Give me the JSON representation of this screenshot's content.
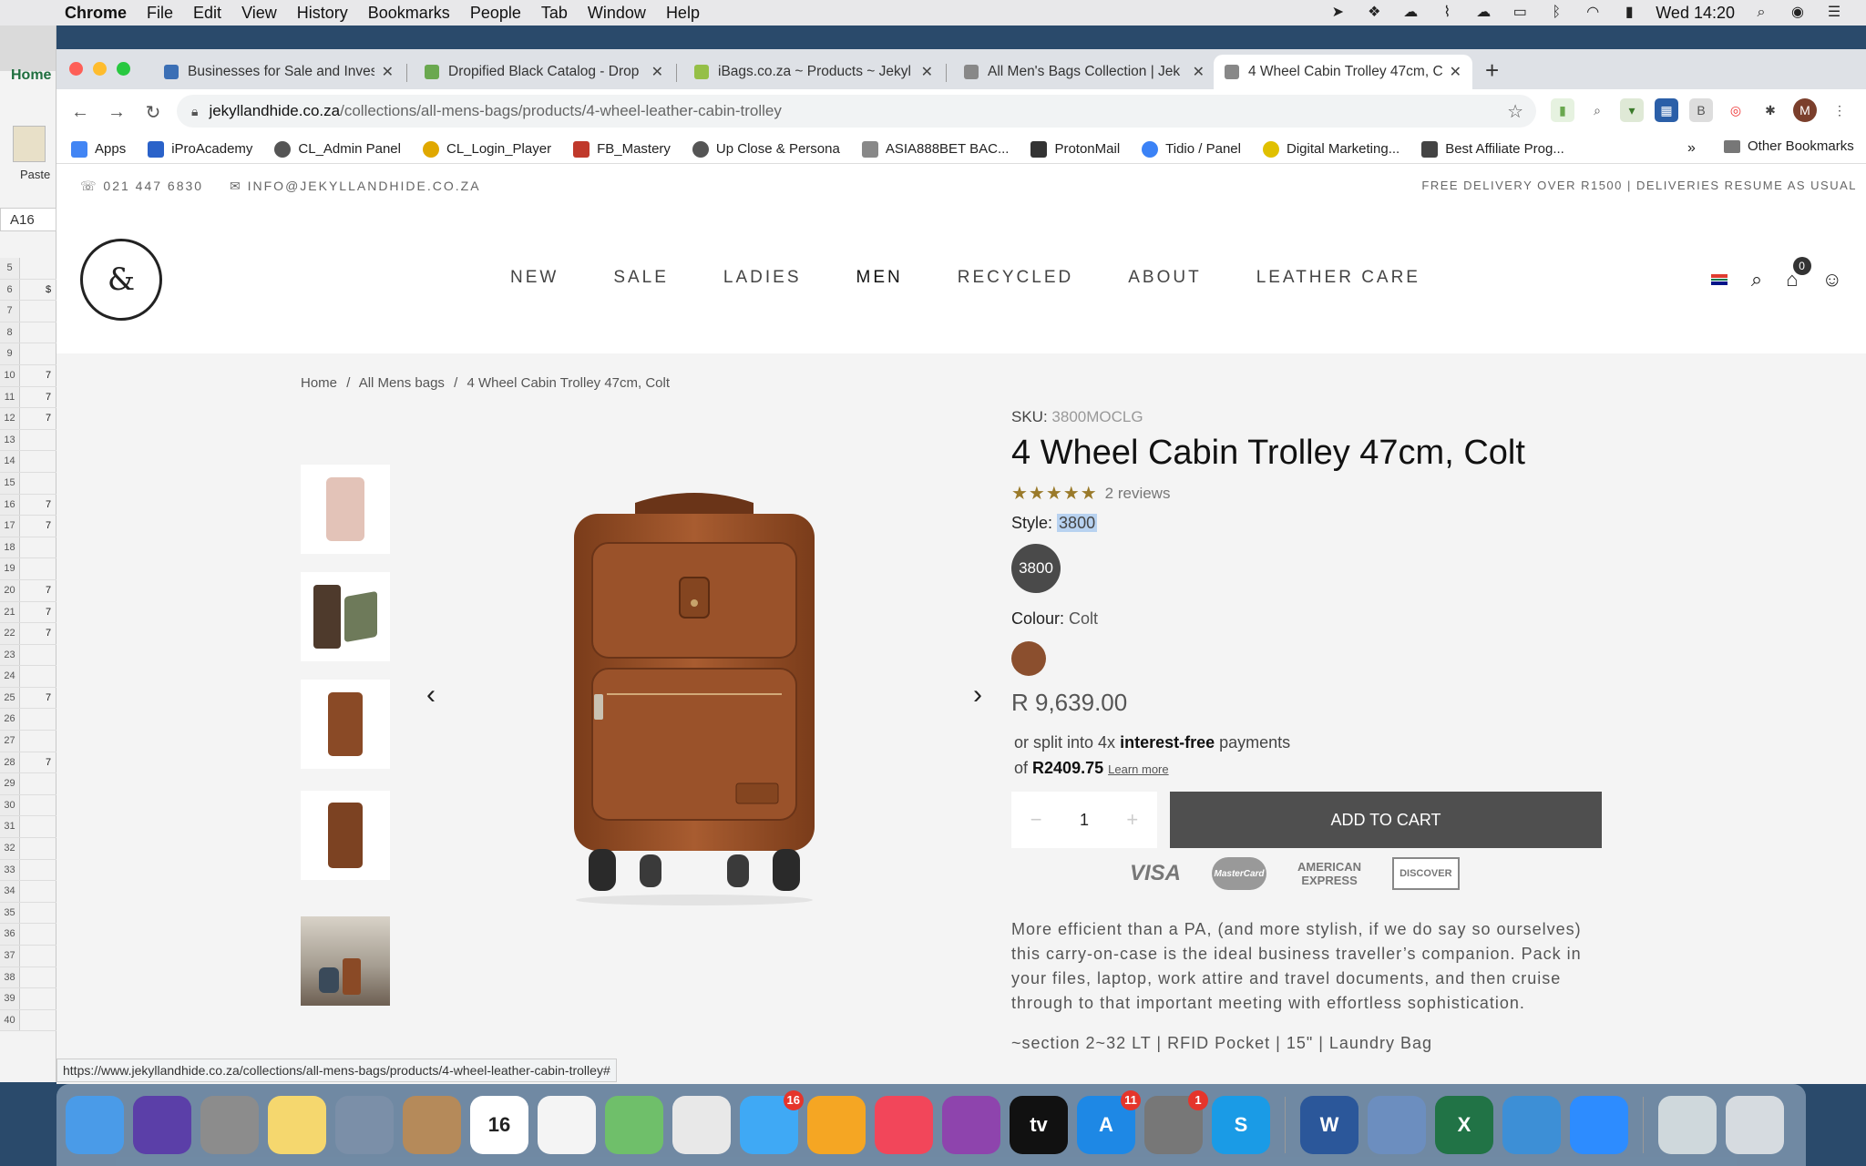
{
  "menubar": {
    "app": "Chrome",
    "items": [
      "File",
      "Edit",
      "View",
      "History",
      "Bookmarks",
      "People",
      "Tab",
      "Window",
      "Help"
    ],
    "clock": "Wed 14:20"
  },
  "excel": {
    "home_tab": "Home",
    "paste_label": "Paste",
    "cell_ref": "A16",
    "rows": [
      {
        "n": "5",
        "v": ""
      },
      {
        "n": "6",
        "v": "$"
      },
      {
        "n": "7",
        "v": ""
      },
      {
        "n": "8",
        "v": ""
      },
      {
        "n": "9",
        "v": ""
      },
      {
        "n": "10",
        "v": "7"
      },
      {
        "n": "11",
        "v": "7"
      },
      {
        "n": "12",
        "v": "7"
      },
      {
        "n": "13",
        "v": ""
      },
      {
        "n": "14",
        "v": ""
      },
      {
        "n": "15",
        "v": ""
      },
      {
        "n": "16",
        "v": "7"
      },
      {
        "n": "17",
        "v": "7"
      },
      {
        "n": "18",
        "v": ""
      },
      {
        "n": "19",
        "v": ""
      },
      {
        "n": "20",
        "v": "7"
      },
      {
        "n": "21",
        "v": "7"
      },
      {
        "n": "22",
        "v": "7"
      },
      {
        "n": "23",
        "v": ""
      },
      {
        "n": "24",
        "v": ""
      },
      {
        "n": "25",
        "v": "7"
      },
      {
        "n": "26",
        "v": ""
      },
      {
        "n": "27",
        "v": ""
      },
      {
        "n": "28",
        "v": "7"
      },
      {
        "n": "29",
        "v": ""
      },
      {
        "n": "30",
        "v": ""
      },
      {
        "n": "31",
        "v": ""
      },
      {
        "n": "32",
        "v": ""
      },
      {
        "n": "33",
        "v": ""
      },
      {
        "n": "34",
        "v": ""
      },
      {
        "n": "35",
        "v": ""
      },
      {
        "n": "36",
        "v": ""
      },
      {
        "n": "37",
        "v": ""
      },
      {
        "n": "38",
        "v": ""
      },
      {
        "n": "39",
        "v": ""
      },
      {
        "n": "40",
        "v": ""
      }
    ]
  },
  "tabs": [
    {
      "title": "Businesses for Sale and Investo",
      "color": "#3b6fb5"
    },
    {
      "title": "Dropified Black Catalog - Drop",
      "color": "#6aa84f"
    },
    {
      "title": "iBags.co.za ~ Products ~ Jekyl",
      "color": "#95bf47"
    },
    {
      "title": "All Men's Bags Collection | Jek",
      "color": "#888888"
    },
    {
      "title": "4 Wheel Cabin Trolley 47cm, C",
      "color": "#888888"
    }
  ],
  "toolbar": {
    "url_host": "jekyllandhide.co.za",
    "url_path": "/collections/all-mens-bags/products/4-wheel-leather-cabin-trolley",
    "avatar_letter": "M"
  },
  "bookmarks": {
    "items": [
      {
        "label": "Apps",
        "color": "#4285f4"
      },
      {
        "label": "iProAcademy",
        "color": "#2a62c9"
      },
      {
        "label": "CL_Admin Panel",
        "color": "#555555"
      },
      {
        "label": "CL_Login_Player",
        "color": "#e0a800"
      },
      {
        "label": "FB_Mastery",
        "color": "#c0392b"
      },
      {
        "label": "Up Close & Persona",
        "color": "#555555"
      },
      {
        "label": "ASIA888BET BAC...",
        "color": "#888888"
      },
      {
        "label": "ProtonMail",
        "color": "#333333"
      },
      {
        "label": "Tidio / Panel",
        "color": "#3b82f6"
      },
      {
        "label": "Digital Marketing...",
        "color": "#e0c000"
      },
      {
        "label": "Best Affiliate Prog...",
        "color": "#444444"
      }
    ],
    "more": "»",
    "other": "Other Bookmarks"
  },
  "site": {
    "phone": "021 447 6830",
    "email": "INFO@JEKYLLANDHIDE.CO.ZA",
    "delivery": "FREE DELIVERY OVER R1500 | DELIVERIES RESUME AS USUAL",
    "nav": [
      "NEW",
      "SALE",
      "LADIES",
      "MEN",
      "RECYCLED",
      "ABOUT",
      "LEATHER CARE"
    ],
    "active_nav": "MEN",
    "cart_count": "0",
    "breadcrumb": [
      "Home",
      "/",
      "All Mens bags",
      "/",
      "4 Wheel Cabin Trolley 47cm, Colt"
    ]
  },
  "product": {
    "sku_label": "SKU:",
    "sku": "3800MOCLG",
    "title": "4 Wheel Cabin Trolley 47cm, Colt",
    "stars": "★★★★★",
    "rating_value": 5,
    "reviews": "2 reviews",
    "style_label": "Style:",
    "style_value": "3800",
    "style_chip": "3800",
    "colour_label": "Colour:",
    "colour_value": "Colt",
    "colour_hex": "#8b4f2e",
    "price": "R 9,639.00",
    "split_pre": "or split into 4x",
    "split_bold": "interest-free",
    "split_post": "payments",
    "split_of": "of",
    "split_amount": "R2409.75",
    "learn_more": "Learn more",
    "qty_minus": "−",
    "quantity": "1",
    "qty_plus": "+",
    "add_to_cart": "ADD TO CART",
    "payment_methods": {
      "visa": "VISA",
      "mastercard": "MasterCard",
      "amex_1": "AMERICAN",
      "amex_2": "EXPRESS",
      "discover": "DISCOVER"
    },
    "description": "More efficient than a PA, (and more stylish, if we do say so ourselves) this carry-on-case is the ideal business traveller’s companion. Pack in your files, laptop, work attire and travel documents, and then cruise through to that important meeting with effortless sophistication.",
    "features": "~section 2~32 LT | RFID Pocket | 15\" | Laundry Bag"
  },
  "status_url": "https://www.jekyllandhide.co.za/collections/all-mens-bags/products/4-wheel-leather-cabin-trolley#",
  "dock": {
    "apps": [
      {
        "name": "finder-icon",
        "color": "#4a9be8",
        "label": "",
        "badge": ""
      },
      {
        "name": "siri-icon",
        "color": "#5b3fa8",
        "label": "",
        "badge": ""
      },
      {
        "name": "launchpad-icon",
        "color": "#8c8c8c",
        "label": "",
        "badge": ""
      },
      {
        "name": "notes-icon",
        "color": "#f5d76e",
        "label": "",
        "badge": ""
      },
      {
        "name": "mail-stamp-icon",
        "color": "#7b8fa8",
        "label": "",
        "badge": ""
      },
      {
        "name": "contacts-icon",
        "color": "#b58a5a",
        "label": "",
        "badge": ""
      },
      {
        "name": "calendar-icon",
        "color": "#ffffff",
        "label": "16",
        "badge": ""
      },
      {
        "name": "reminders-icon",
        "color": "#f4f4f4",
        "label": "",
        "badge": ""
      },
      {
        "name": "maps-icon",
        "color": "#6fbf6a",
        "label": "",
        "badge": ""
      },
      {
        "name": "chrome-icon",
        "color": "#e8e8e8",
        "label": "",
        "badge": ""
      },
      {
        "name": "messages-icon",
        "color": "#3fa9f5",
        "label": "",
        "badge": "16"
      },
      {
        "name": "photos-icon",
        "color": "#f5a623",
        "label": "",
        "badge": ""
      },
      {
        "name": "music-icon",
        "color": "#f2465a",
        "label": "",
        "badge": ""
      },
      {
        "name": "podcasts-icon",
        "color": "#8e44ad",
        "label": "",
        "badge": ""
      },
      {
        "name": "tv-icon",
        "color": "#111111",
        "label": "tv",
        "badge": ""
      },
      {
        "name": "app-store-icon",
        "color": "#1e88e5",
        "label": "A",
        "badge": "11"
      },
      {
        "name": "system-preferences-icon",
        "color": "#777777",
        "label": "",
        "badge": "1"
      },
      {
        "name": "skype-icon",
        "color": "#1a9be6",
        "label": "S",
        "badge": ""
      },
      {
        "name": "sep",
        "color": "",
        "label": "",
        "badge": ""
      },
      {
        "name": "word-icon",
        "color": "#2b579a",
        "label": "W",
        "badge": ""
      },
      {
        "name": "preview-icon",
        "color": "#6c8ebf",
        "label": "",
        "badge": ""
      },
      {
        "name": "excel-icon",
        "color": "#217346",
        "label": "X",
        "badge": ""
      },
      {
        "name": "shield-app-icon",
        "color": "#3d8fd6",
        "label": "",
        "badge": ""
      },
      {
        "name": "zoom-icon",
        "color": "#2d8cff",
        "label": "",
        "badge": ""
      },
      {
        "name": "sep",
        "color": "",
        "label": "",
        "badge": ""
      },
      {
        "name": "downloads-icon",
        "color": "#cfd8dc",
        "label": "",
        "badge": ""
      },
      {
        "name": "trash-icon",
        "color": "#d6dbe0",
        "label": "",
        "badge": ""
      }
    ]
  }
}
